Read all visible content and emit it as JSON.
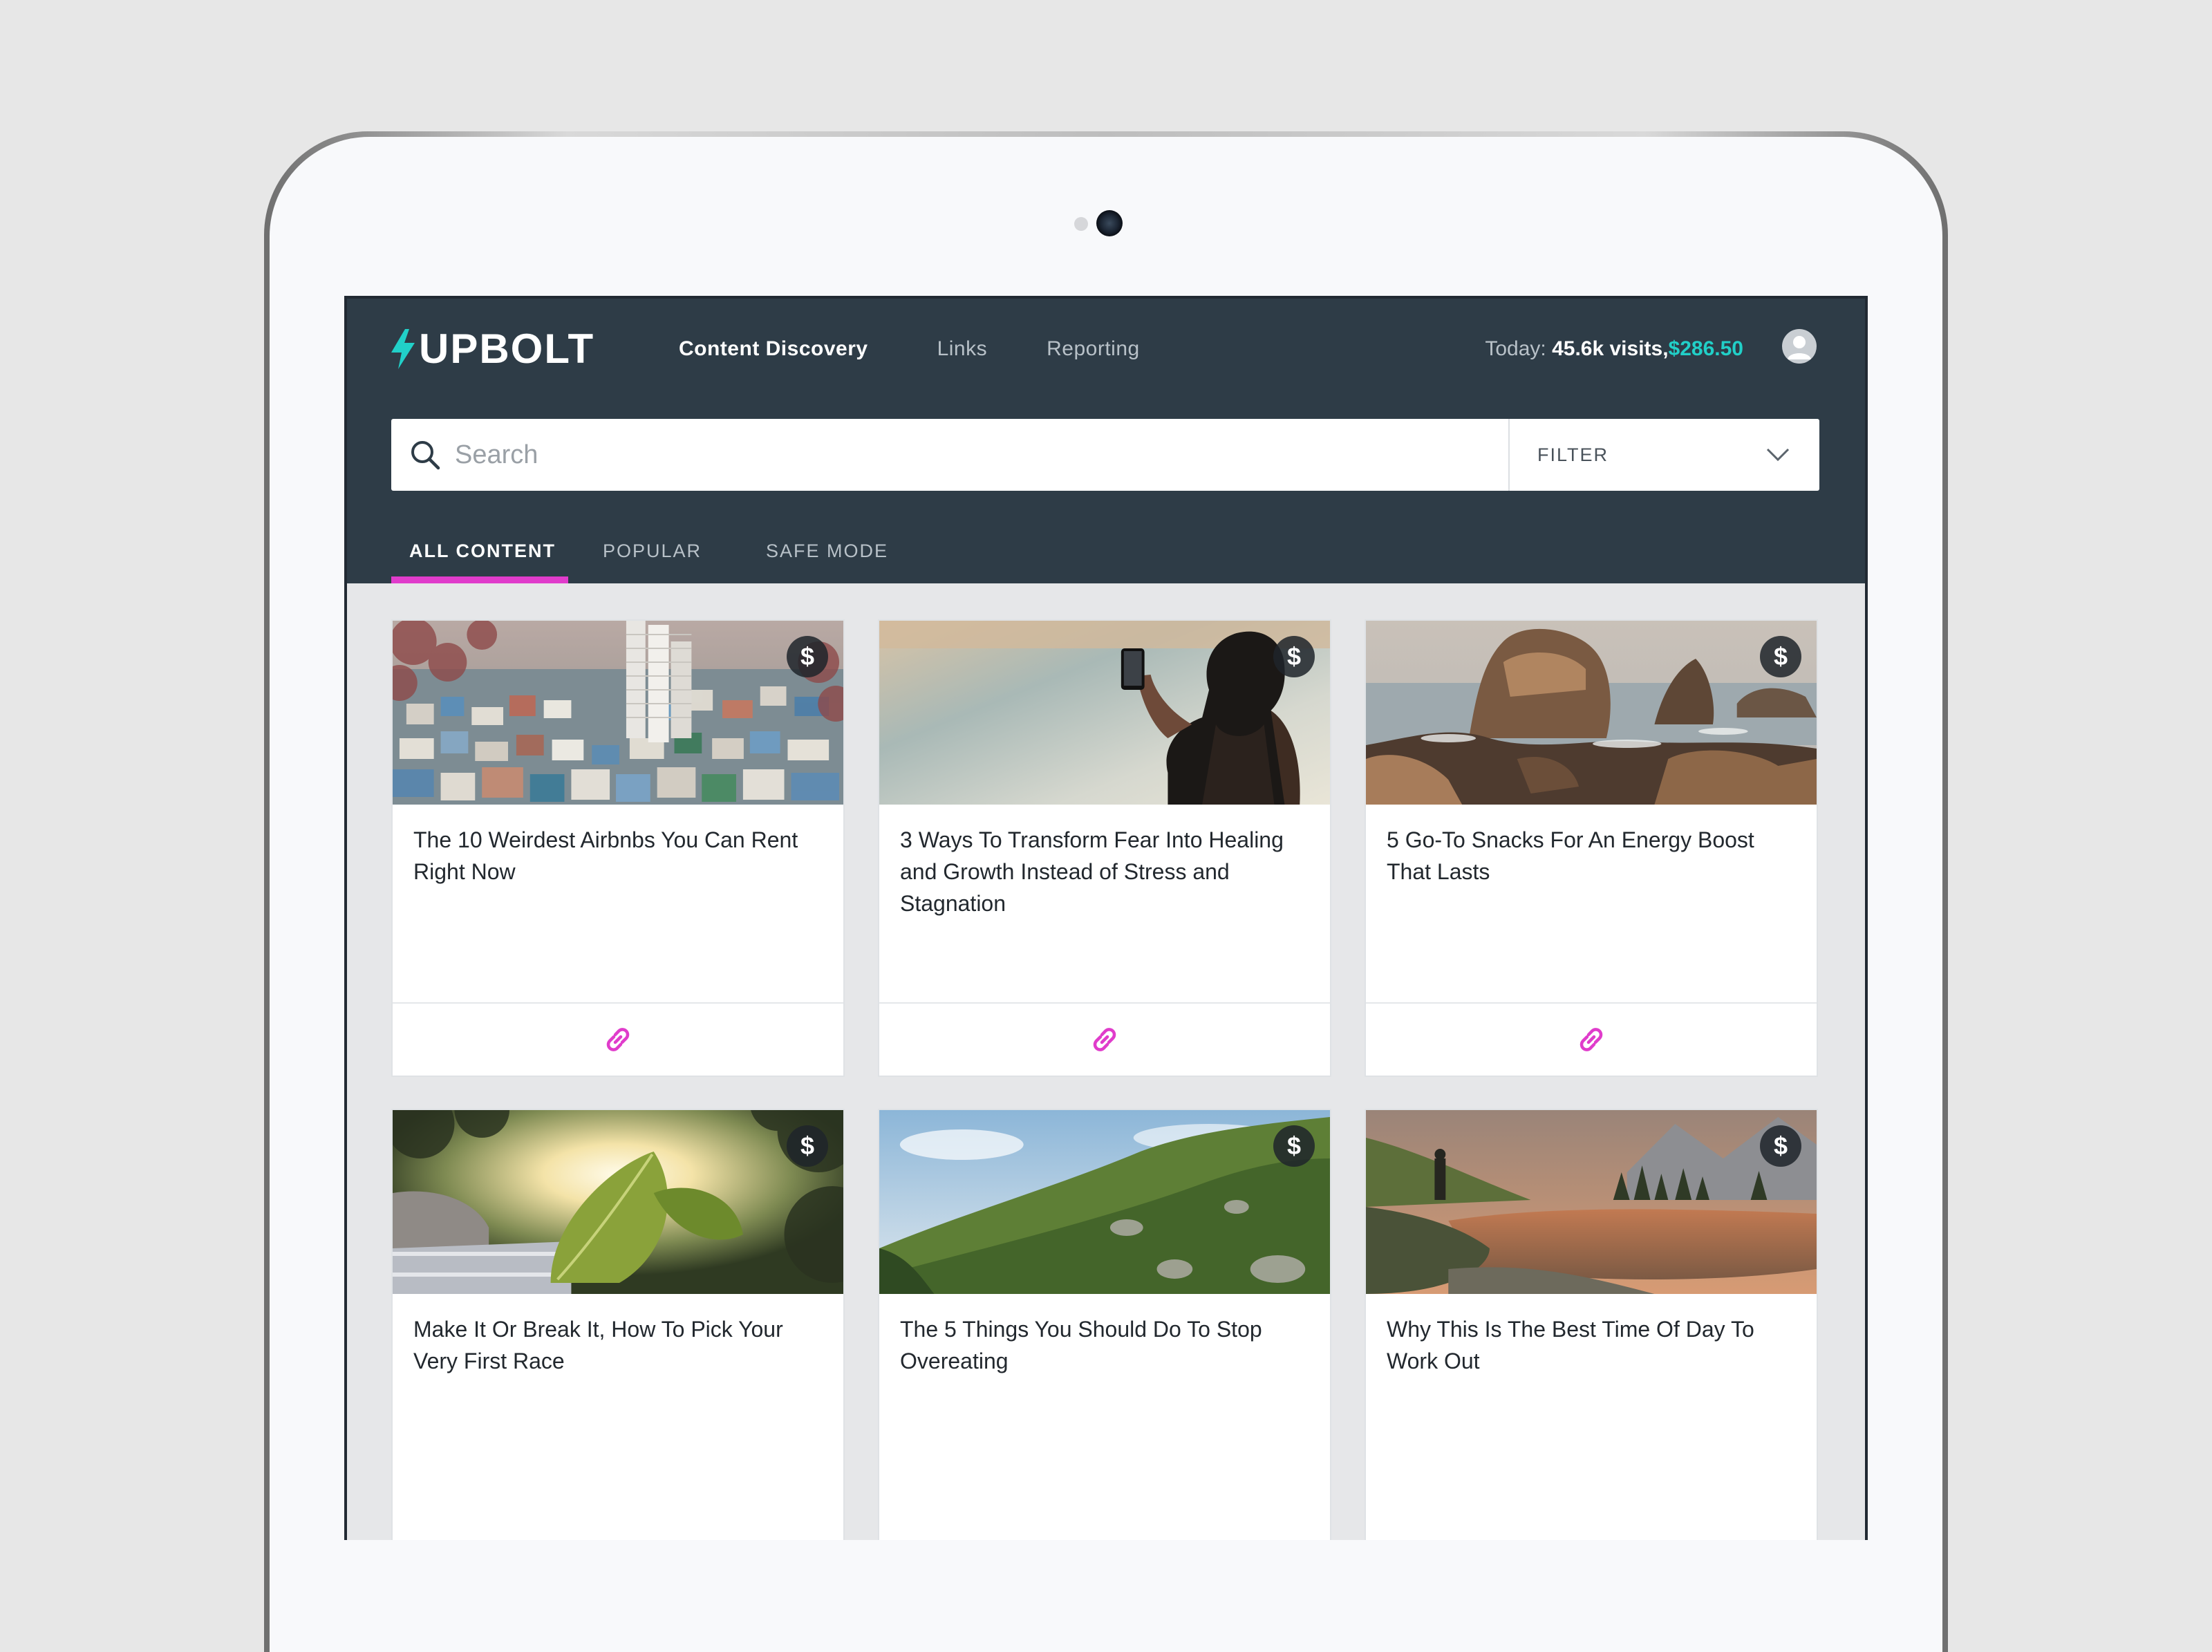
{
  "app": {
    "logo_text": "UPBOLT",
    "accent_color": "#e03ccb",
    "money_color": "#21d0c8",
    "header_color": "#2e3c47"
  },
  "nav": {
    "items": [
      {
        "label": "Content Discovery",
        "active": true
      },
      {
        "label": "Links",
        "active": false
      },
      {
        "label": "Reporting",
        "active": false
      }
    ]
  },
  "stats": {
    "prefix": "Today: ",
    "visits": "45.6k visits,",
    "earnings": "$286.50"
  },
  "search": {
    "placeholder": "Search",
    "value": "",
    "filter_label": "FILTER"
  },
  "tabs": [
    {
      "label": "ALL CONTENT",
      "active": true
    },
    {
      "label": "POPULAR",
      "active": false
    },
    {
      "label": "SAFE MODE",
      "active": false
    }
  ],
  "cards": [
    {
      "title": "The 10 Weirdest Airbnbs You Can Rent Right Now",
      "image": "hillside-city",
      "badge": "$",
      "action_icon": "link-icon"
    },
    {
      "title": "3 Ways To Transform Fear Into Healing and Growth Instead of Stress and Stagnation",
      "image": "woman-phone-beach",
      "badge": "$",
      "action_icon": "link-icon"
    },
    {
      "title": "5 Go-To Snacks For An Energy Boost That Lasts",
      "image": "rocky-coast",
      "badge": "$",
      "action_icon": "link-icon"
    },
    {
      "title": "Make It Or Break It, How To Pick Your Very First Race",
      "image": "leaf-sunlight",
      "badge": "$",
      "action_icon": "link-icon"
    },
    {
      "title": "The 5 Things You Should Do To Stop Overeating",
      "image": "green-hills",
      "badge": "$",
      "action_icon": "link-icon"
    },
    {
      "title": "Why This Is The Best Time Of Day To Work Out",
      "image": "mountain-lake-sunset",
      "badge": "$",
      "action_icon": "link-icon"
    }
  ]
}
